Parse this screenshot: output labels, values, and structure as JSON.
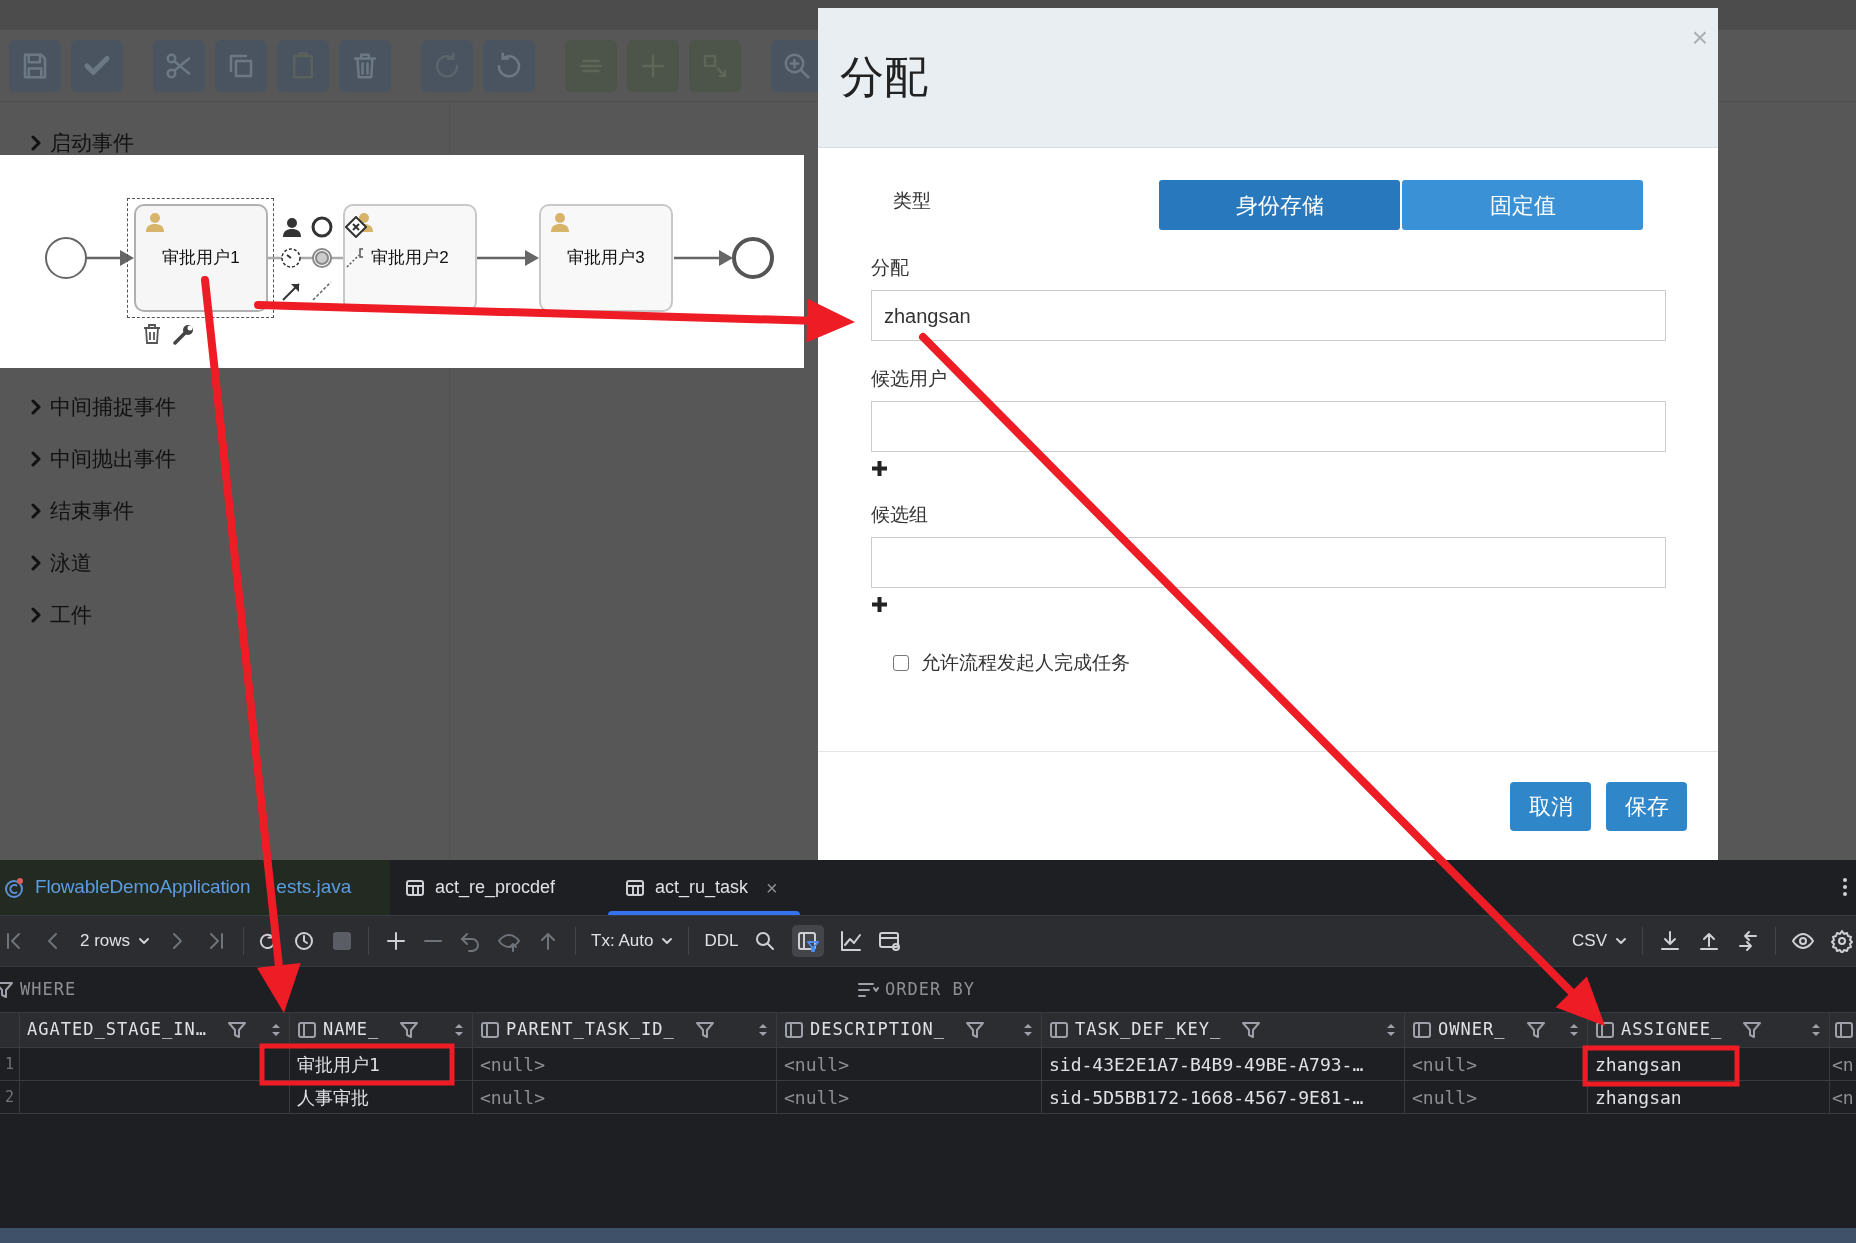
{
  "background": {
    "palette": [
      {
        "label": "启动事件"
      },
      {
        "label": "中间捕捉事件"
      },
      {
        "label": "中间抛出事件"
      },
      {
        "label": "结束事件"
      },
      {
        "label": "泳道"
      },
      {
        "label": "工件"
      }
    ]
  },
  "diagram": {
    "tasks": [
      {
        "label": "审批用户1",
        "selected": true
      },
      {
        "label": "审批用户2",
        "selected": false
      },
      {
        "label": "审批用户3",
        "selected": false
      }
    ]
  },
  "dialog": {
    "title": "分配",
    "close": "×",
    "type_label": "类型",
    "type_options": [
      {
        "label": "身份存储",
        "selected": true
      },
      {
        "label": "固定值",
        "selected": false
      }
    ],
    "fields": [
      {
        "label": "分配",
        "value": "zhangsan",
        "addable": false
      },
      {
        "label": "候选用户",
        "addable": true
      },
      {
        "label": "候选组",
        "addable": true
      }
    ],
    "checkbox": {
      "label": "允许流程发起人完成任务",
      "checked": false
    },
    "buttons": [
      "取消",
      "保存"
    ]
  },
  "editor": {
    "tabs": [
      {
        "label": "FlowableDemoApplication",
        "label_tail": "ests.java",
        "kind": "class",
        "selected": false
      },
      {
        "label": "act_re_procdef",
        "kind": "table",
        "selected": false
      },
      {
        "label": "act_ru_task",
        "kind": "table",
        "selected": true,
        "close": "×"
      }
    ],
    "toolbar": {
      "rows": "2 rows",
      "transaction": "Tx: Auto",
      "ddl": "DDL",
      "format": "CSV"
    },
    "filter": {
      "where": "WHERE",
      "order_by": "ORDER BY"
    },
    "table": {
      "columns": [
        {
          "name": "AGATED_STAGE_IN…",
          "kind": "cut"
        },
        {
          "name": "NAME_",
          "kind": "full"
        },
        {
          "name": "PARENT_TASK_ID_",
          "kind": "full"
        },
        {
          "name": "DESCRIPTION_",
          "kind": "full"
        },
        {
          "name": "TASK_DEF_KEY_",
          "kind": "full"
        },
        {
          "name": "OWNER_",
          "kind": "full"
        },
        {
          "name": "ASSIGNEE_",
          "kind": "full"
        },
        {
          "kind": "icon_only"
        }
      ],
      "rows": [
        {
          "number": "1",
          "cells": [
            {
              "kind": "empty"
            },
            {
              "text": "审批用户1",
              "kind": "value"
            },
            {
              "text": "<null>",
              "kind": "null"
            },
            {
              "text": "<null>",
              "kind": "null"
            },
            {
              "text": "sid-43E2E1A7-B4B9-49BE-A793-…",
              "kind": "value"
            },
            {
              "text": "<null>",
              "kind": "null"
            },
            {
              "text": "zhangsan",
              "kind": "value"
            },
            {
              "text": "<n",
              "kind": "null"
            }
          ]
        },
        {
          "number": "2",
          "cells": [
            {
              "kind": "empty"
            },
            {
              "text": "人事审批",
              "kind": "value"
            },
            {
              "text": "<null>",
              "kind": "null"
            },
            {
              "text": "<null>",
              "kind": "null"
            },
            {
              "text": "sid-5D5BB172-1668-4567-9E81-…",
              "kind": "value"
            },
            {
              "text": "<null>",
              "kind": "null"
            },
            {
              "text": "zhangsan",
              "kind": "value"
            },
            {
              "text": "<n",
              "kind": "null"
            }
          ]
        }
      ]
    }
  }
}
